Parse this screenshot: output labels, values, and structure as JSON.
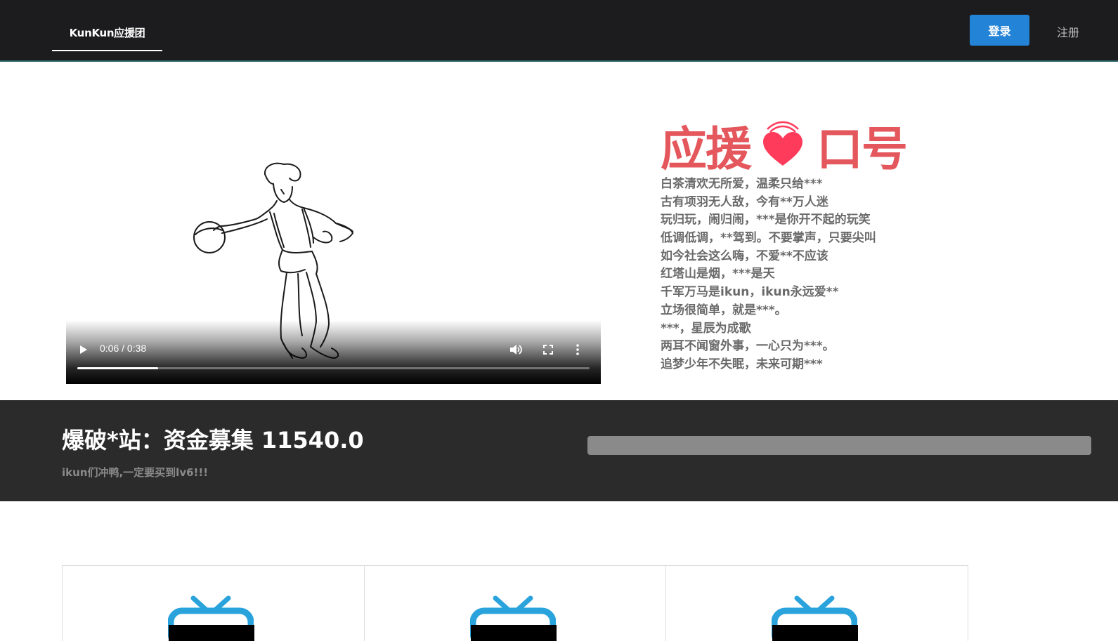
{
  "nav": {
    "brand": "KunKun应援团",
    "login_label": "登录",
    "register_label": "注册"
  },
  "video": {
    "time_display": "0:06 / 0:38",
    "progress_fraction": 0.158
  },
  "slogan": {
    "title_left": "应援",
    "title_right": "口号",
    "lines": [
      "白茶清欢无所爱，温柔只给***",
      "古有项羽无人敌，今有**万人迷",
      "玩归玩，闹归闹，***是你开不起的玩笑",
      "低调低调，**驾到。不要掌声，只要尖叫",
      "如今社会这么嗨，不爱**不应该",
      "红塔山是烟，***是天",
      "千军万马是ikun，ikun永远爱**",
      "立场很简单，就是***。",
      "***，星辰为成歌",
      "两耳不闻窗外事，一心只为***。",
      "追梦少年不失眠，未来可期***"
    ]
  },
  "fund": {
    "title": "爆破*站：资金募集 11540.0",
    "subtitle": "ikun们冲鸭,一定要买到lv6!!!",
    "progress_fraction": 0
  },
  "colors": {
    "nav_bg": "#1c1c1e",
    "accent": "#2383d6",
    "slogan_red": "#e4575c",
    "heart": "#ff3b5c",
    "tv_blue": "#2aa3dc"
  },
  "cards": [
    {
      "icon": "tv-icon"
    },
    {
      "icon": "tv-icon"
    },
    {
      "icon": "tv-icon"
    }
  ]
}
